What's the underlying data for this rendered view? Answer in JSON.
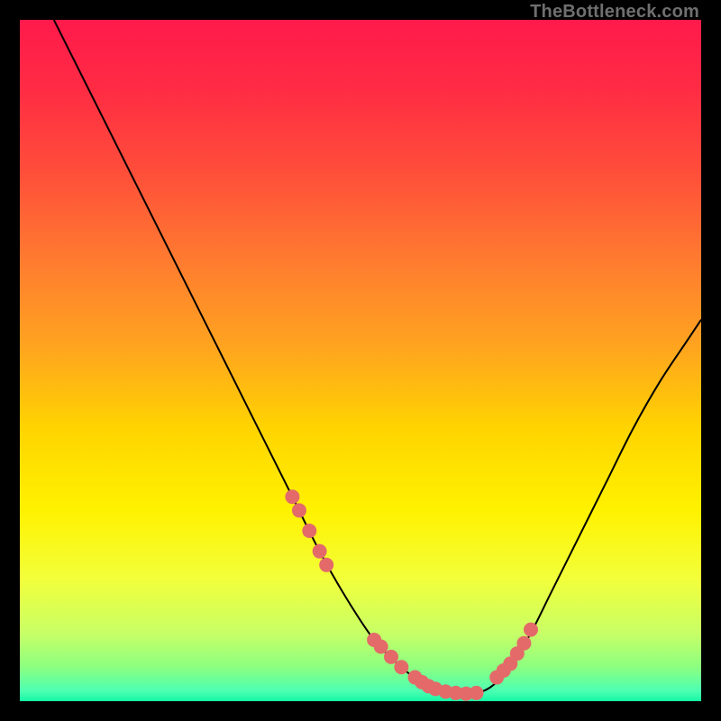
{
  "watermark": "TheBottleneck.com",
  "chart_data": {
    "type": "line",
    "title": "",
    "xlabel": "",
    "ylabel": "",
    "xlim": [
      0,
      100
    ],
    "ylim": [
      0,
      100
    ],
    "series": [
      {
        "name": "curve",
        "x": [
          5,
          8,
          12,
          16,
          20,
          24,
          28,
          32,
          36,
          40,
          44,
          48,
          52,
          56,
          60,
          63,
          66,
          69,
          72,
          75,
          78,
          82,
          86,
          90,
          94,
          98,
          100
        ],
        "y": [
          100,
          94,
          86,
          78,
          70,
          62,
          54,
          46,
          38,
          30,
          22,
          15,
          9,
          5,
          2,
          1,
          1,
          2,
          5,
          10,
          16,
          24,
          32,
          40,
          47,
          53,
          56
        ]
      }
    ],
    "highlight_points": {
      "name": "dots",
      "x": [
        40,
        41,
        42.5,
        44,
        45,
        52,
        53,
        54.5,
        56,
        58,
        59,
        60,
        61,
        62.5,
        64,
        65.5,
        67,
        70,
        71,
        72,
        73,
        74,
        75
      ],
      "y": [
        30,
        28,
        25,
        22,
        20,
        9,
        8,
        6.5,
        5,
        3.5,
        2.8,
        2.2,
        1.8,
        1.4,
        1.2,
        1.1,
        1.2,
        3.5,
        4.5,
        5.5,
        7,
        8.5,
        10.5
      ]
    },
    "gradient_stops": [
      {
        "offset": 0.0,
        "color": "#ff1a4b"
      },
      {
        "offset": 0.1,
        "color": "#ff2b44"
      },
      {
        "offset": 0.22,
        "color": "#ff4d3a"
      },
      {
        "offset": 0.35,
        "color": "#ff7a30"
      },
      {
        "offset": 0.48,
        "color": "#ffa41f"
      },
      {
        "offset": 0.6,
        "color": "#ffd400"
      },
      {
        "offset": 0.72,
        "color": "#fff200"
      },
      {
        "offset": 0.82,
        "color": "#f2ff3a"
      },
      {
        "offset": 0.9,
        "color": "#c8ff66"
      },
      {
        "offset": 0.95,
        "color": "#8cff80"
      },
      {
        "offset": 0.985,
        "color": "#4dffb3"
      },
      {
        "offset": 1.0,
        "color": "#15f7a4"
      }
    ],
    "dot_color": "#e46a6a",
    "curve_color": "#000000"
  }
}
